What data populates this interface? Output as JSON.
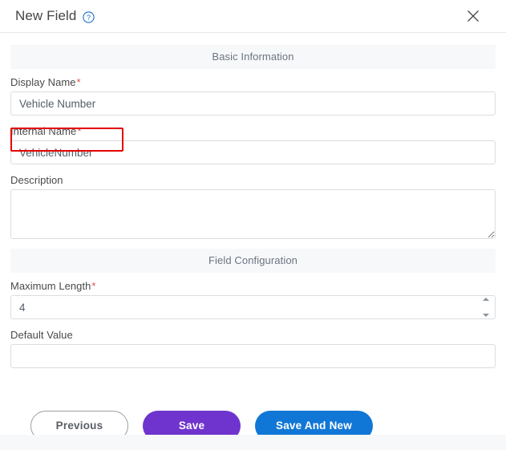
{
  "header": {
    "title": "New Field",
    "help_icon": "question-circle-icon",
    "close_icon": "close-icon"
  },
  "sections": {
    "basic_information": {
      "title": "Basic Information",
      "fields": {
        "display_name": {
          "label": "Display Name",
          "required_marker": "*",
          "value": "Vehicle Number",
          "placeholder": ""
        },
        "internal_name": {
          "label": "Internal Name",
          "required_marker": "*",
          "value": "VehicleNumber",
          "placeholder": ""
        },
        "description": {
          "label": "Description",
          "value": "",
          "placeholder": ""
        }
      }
    },
    "field_configuration": {
      "title": "Field Configuration",
      "fields": {
        "maximum_length": {
          "label": "Maximum Length",
          "required_marker": "*",
          "value": "4",
          "placeholder": ""
        },
        "default_value": {
          "label": "Default Value",
          "value": "",
          "placeholder": ""
        }
      }
    }
  },
  "footer": {
    "previous_label": "Previous",
    "save_label": "Save",
    "save_and_new_label": "Save And New"
  },
  "colors": {
    "save_purple": "#6f34ce",
    "save_new_blue": "#1177d6",
    "required_red": "#d9534f",
    "annotation_red": "#e60000",
    "section_bg": "#f7f8fa",
    "help_blue": "#1a6bc4"
  }
}
